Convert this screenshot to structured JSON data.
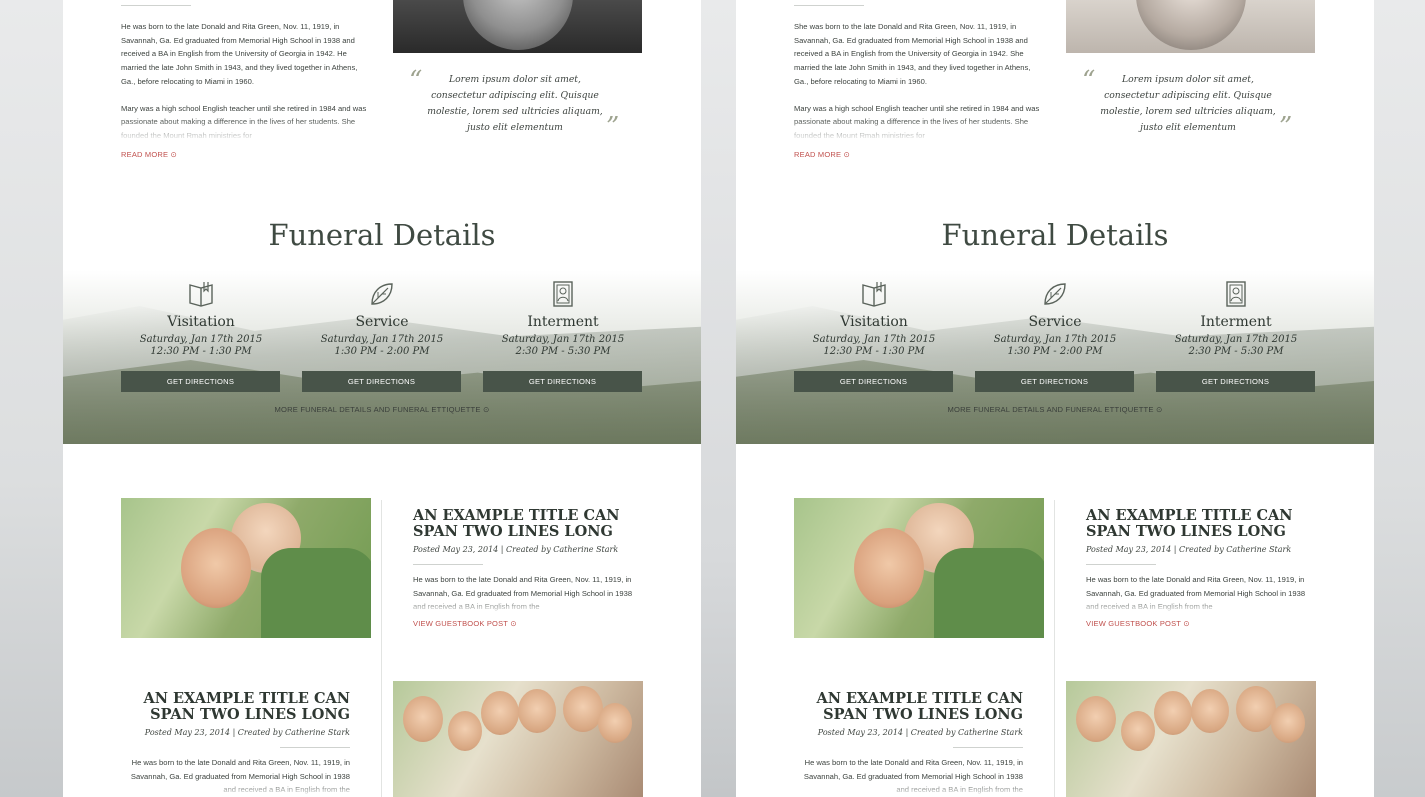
{
  "panels": [
    {
      "bio": {
        "paragraph_1": "He was born to the late Donald and Rita Green, Nov. 11, 1919, in Savannah, Ga. Ed graduated from Memorial High School in 1938 and received a BA in English from the University of Georgia in 1942. He married the late John Smith in 1943, and they lived together in Athens, Ga., before relocating to Miami in 1960.",
        "paragraph_2": "Mary was a high school English teacher until she retired in 1984 and was passionate about making a difference in the lives of her students. She founded the Mount Rmah ministries for",
        "read_more": "READ MORE ⊙"
      },
      "quote": {
        "open_mark": "“",
        "text": "Lorem ipsum dolor sit amet, consectetur adipiscing elit. Quisque molestie, lorem sed ultricies aliquam, justo elit elementum",
        "close_mark": "”"
      },
      "funeral": {
        "title": "Funeral Details",
        "columns": [
          {
            "icon": "book-icon",
            "name": "Visitation",
            "date": "Saturday, Jan 17th 2015",
            "time": "12:30 PM - 1:30 PM",
            "button": "GET DIRECTIONS"
          },
          {
            "icon": "leaf-icon",
            "name": "Service",
            "date": "Saturday, Jan 17th 2015",
            "time": "1:30 PM - 2:00 PM",
            "button": "GET DIRECTIONS"
          },
          {
            "icon": "portrait-frame-icon",
            "name": "Interment",
            "date": "Saturday, Jan 17th 2015",
            "time": "2:30 PM - 5:30 PM",
            "button": "GET DIRECTIONS"
          }
        ],
        "more_link": "MORE FUNERAL DETAILS AND FUNERAL ETTIQUETTE ⊙"
      },
      "posts": [
        {
          "title": "AN EXAMPLE TITLE CAN SPAN TWO LINES LONG",
          "meta": "Posted May 23, 2014  |  Created by Catherine Stark",
          "excerpt": "He was born to the late Donald and Rita Green, Nov. 11, 1919, in Savannah, Ga. Ed graduated from Memorial High School in 1938 and received a BA in English from the",
          "link": "VIEW GUESTBOOK POST ⊙"
        },
        {
          "title": "AN EXAMPLE TITLE CAN SPAN TWO LINES LONG",
          "meta": "Posted May 23, 2014  |  Created by Catherine Stark",
          "excerpt": "He was born to the late Donald and Rita Green, Nov. 11, 1919, in Savannah, Ga. Ed graduated from Memorial High School in 1938 and received a BA in English from the"
        }
      ]
    },
    {
      "bio": {
        "paragraph_1": "She was born to the late Donald and Rita Green, Nov. 11, 1919, in Savannah, Ga. Ed graduated from Memorial High School in 1938 and received a BA in English from the University of Georgia in 1942. She married the late John Smith in 1943, and they lived together in Athens, Ga., before relocating to Miami in 1960.",
        "paragraph_2": "Mary was a high school English teacher until she retired in 1984 and was passionate about making a difference in the lives of her students. She founded the Mount Rmah ministries for",
        "read_more": "READ MORE ⊙"
      },
      "quote": {
        "open_mark": "“",
        "text": "Lorem ipsum dolor sit amet, consectetur adipiscing elit. Quisque molestie, lorem sed ultricies aliquam, justo elit elementum",
        "close_mark": "”"
      },
      "funeral": {
        "title": "Funeral Details",
        "columns": [
          {
            "icon": "book-icon",
            "name": "Visitation",
            "date": "Saturday, Jan 17th 2015",
            "time": "12:30 PM - 1:30 PM",
            "button": "GET DIRECTIONS"
          },
          {
            "icon": "leaf-icon",
            "name": "Service",
            "date": "Saturday, Jan 17th 2015",
            "time": "1:30 PM - 2:00 PM",
            "button": "GET DIRECTIONS"
          },
          {
            "icon": "portrait-frame-icon",
            "name": "Interment",
            "date": "Saturday, Jan 17th 2015",
            "time": "2:30 PM - 5:30 PM",
            "button": "GET DIRECTIONS"
          }
        ],
        "more_link": "MORE FUNERAL DETAILS AND FUNERAL ETTIQUETTE ⊙"
      },
      "posts": [
        {
          "title": "AN EXAMPLE TITLE CAN SPAN TWO LINES LONG",
          "meta": "Posted May 23, 2014  |  Created by Catherine Stark",
          "excerpt": "He was born to the late Donald and Rita Green, Nov. 11, 1919, in Savannah, Ga. Ed graduated from Memorial High School in 1938 and received a BA in English from the",
          "link": "VIEW GUESTBOOK POST ⊙"
        },
        {
          "title": "AN EXAMPLE TITLE CAN SPAN TWO LINES LONG",
          "meta": "Posted May 23, 2014  |  Created by Catherine Stark",
          "excerpt": "He was born to the late Donald and Rita Green, Nov. 11, 1919, in Savannah, Ga. Ed graduated from Memorial High School in 1938 and received a BA in English from the"
        }
      ]
    }
  ],
  "colors": {
    "accent_red": "#c0504d",
    "button_green": "#485449",
    "heading": "#3f4a42"
  }
}
